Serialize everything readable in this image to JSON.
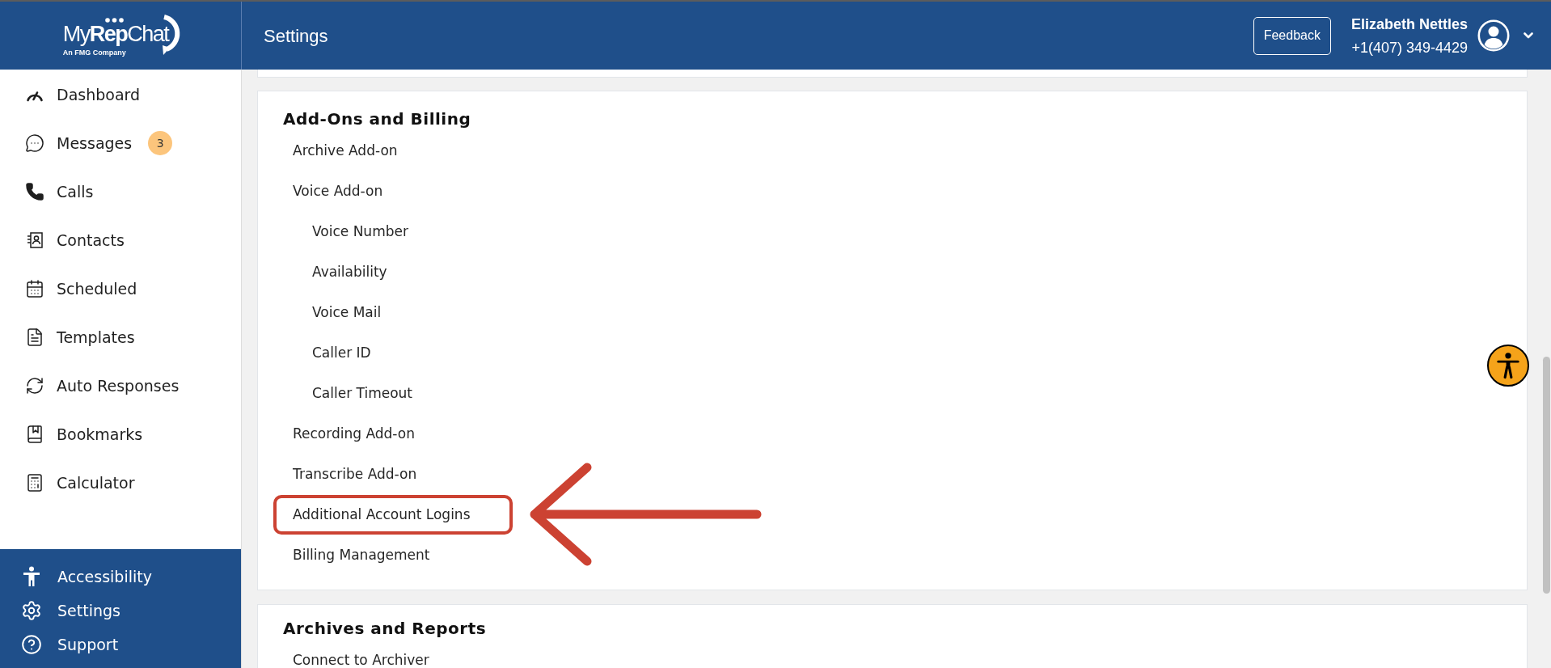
{
  "header": {
    "logo": {
      "wordmark": "My**Rep**Chat",
      "tagline": "An FMG Company"
    },
    "title": "Settings",
    "feedback_button": "Feedback",
    "user": {
      "name": "Elizabeth Nettles",
      "phone": "+1(407) 349-4429"
    }
  },
  "sidebar": {
    "items": [
      {
        "label": "Dashboard"
      },
      {
        "label": "Messages",
        "badge": "3"
      },
      {
        "label": "Calls"
      },
      {
        "label": "Contacts"
      },
      {
        "label": "Scheduled"
      },
      {
        "label": "Templates"
      },
      {
        "label": "Auto Responses"
      },
      {
        "label": "Bookmarks"
      },
      {
        "label": "Calculator"
      }
    ],
    "footer_items": [
      {
        "label": "Accessibility"
      },
      {
        "label": "Settings"
      },
      {
        "label": "Support"
      }
    ]
  },
  "sections": [
    {
      "title": "Add-Ons and Billing",
      "items": [
        {
          "label": "Archive Add-on",
          "highlighted": false
        },
        {
          "label": "Voice Add-on",
          "highlighted": false,
          "children": [
            {
              "label": "Voice Number",
              "highlighted": false
            },
            {
              "label": "Availability",
              "highlighted": false
            },
            {
              "label": "Voice Mail",
              "highlighted": false
            },
            {
              "label": "Caller ID",
              "highlighted": false
            },
            {
              "label": "Caller Timeout",
              "highlighted": false
            }
          ]
        },
        {
          "label": "Recording Add-on",
          "highlighted": false
        },
        {
          "label": "Transcribe Add-on",
          "highlighted": false
        },
        {
          "label": "Additional Account Logins",
          "highlighted": true
        },
        {
          "label": "Billing Management",
          "highlighted": false
        }
      ]
    },
    {
      "title": "Archives and Reports",
      "items": [
        {
          "label": "Connect to Archiver",
          "highlighted": false
        }
      ]
    }
  ]
}
